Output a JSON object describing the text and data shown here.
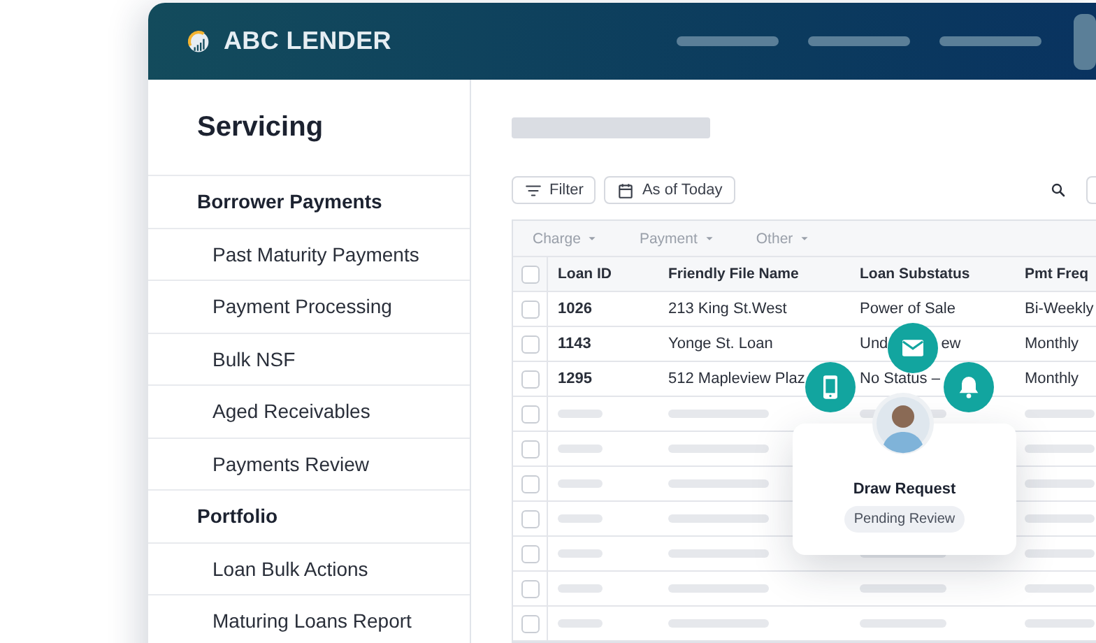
{
  "header": {
    "brand": "ABC LENDER"
  },
  "sidebar": {
    "title": "Servicing",
    "groups": [
      {
        "label": "Borrower Payments",
        "items": [
          "Past Maturity Payments",
          "Payment Processing",
          "Bulk NSF",
          "Aged Receivables",
          "Payments Review"
        ]
      },
      {
        "label": "Portfolio",
        "items": [
          "Loan Bulk Actions",
          "Maturing Loans Report"
        ]
      }
    ]
  },
  "toolbar": {
    "buttons": [
      {
        "label": "Filter",
        "kind": "filter"
      },
      {
        "label": "As of Today",
        "kind": "calendar"
      }
    ]
  },
  "table": {
    "filters": [
      "Charge",
      "Payment",
      "Other"
    ],
    "all_checked": false,
    "columns": [
      "Loan ID",
      "Friendly File Name",
      "Loan Substatus",
      "Pmt Freq"
    ],
    "rows": [
      {
        "checked": false,
        "cells": [
          "1026",
          "213 King St.West",
          "Power of Sale",
          "Bi-Weekly"
        ]
      },
      {
        "checked": false,
        "cells": [
          "1143",
          "Yonge St. Loan",
          [
            "Und",
            "ew"
          ],
          "Monthly"
        ]
      },
      {
        "checked": false,
        "cells": [
          "1295",
          "512 Mapleview Plaz",
          "No Status –",
          "Monthly"
        ]
      }
    ],
    "placeholder_rows": [
      {
        "checked": false
      },
      {
        "checked": false
      },
      {
        "checked": false
      },
      {
        "checked": false
      },
      {
        "checked": false
      },
      {
        "checked": false
      },
      {
        "checked": false
      }
    ]
  },
  "card": {
    "title": "Draw Request",
    "status": "Pending Review",
    "channels": [
      {
        "kind": "phone"
      },
      {
        "kind": "mail"
      },
      {
        "kind": "bell"
      }
    ]
  }
}
